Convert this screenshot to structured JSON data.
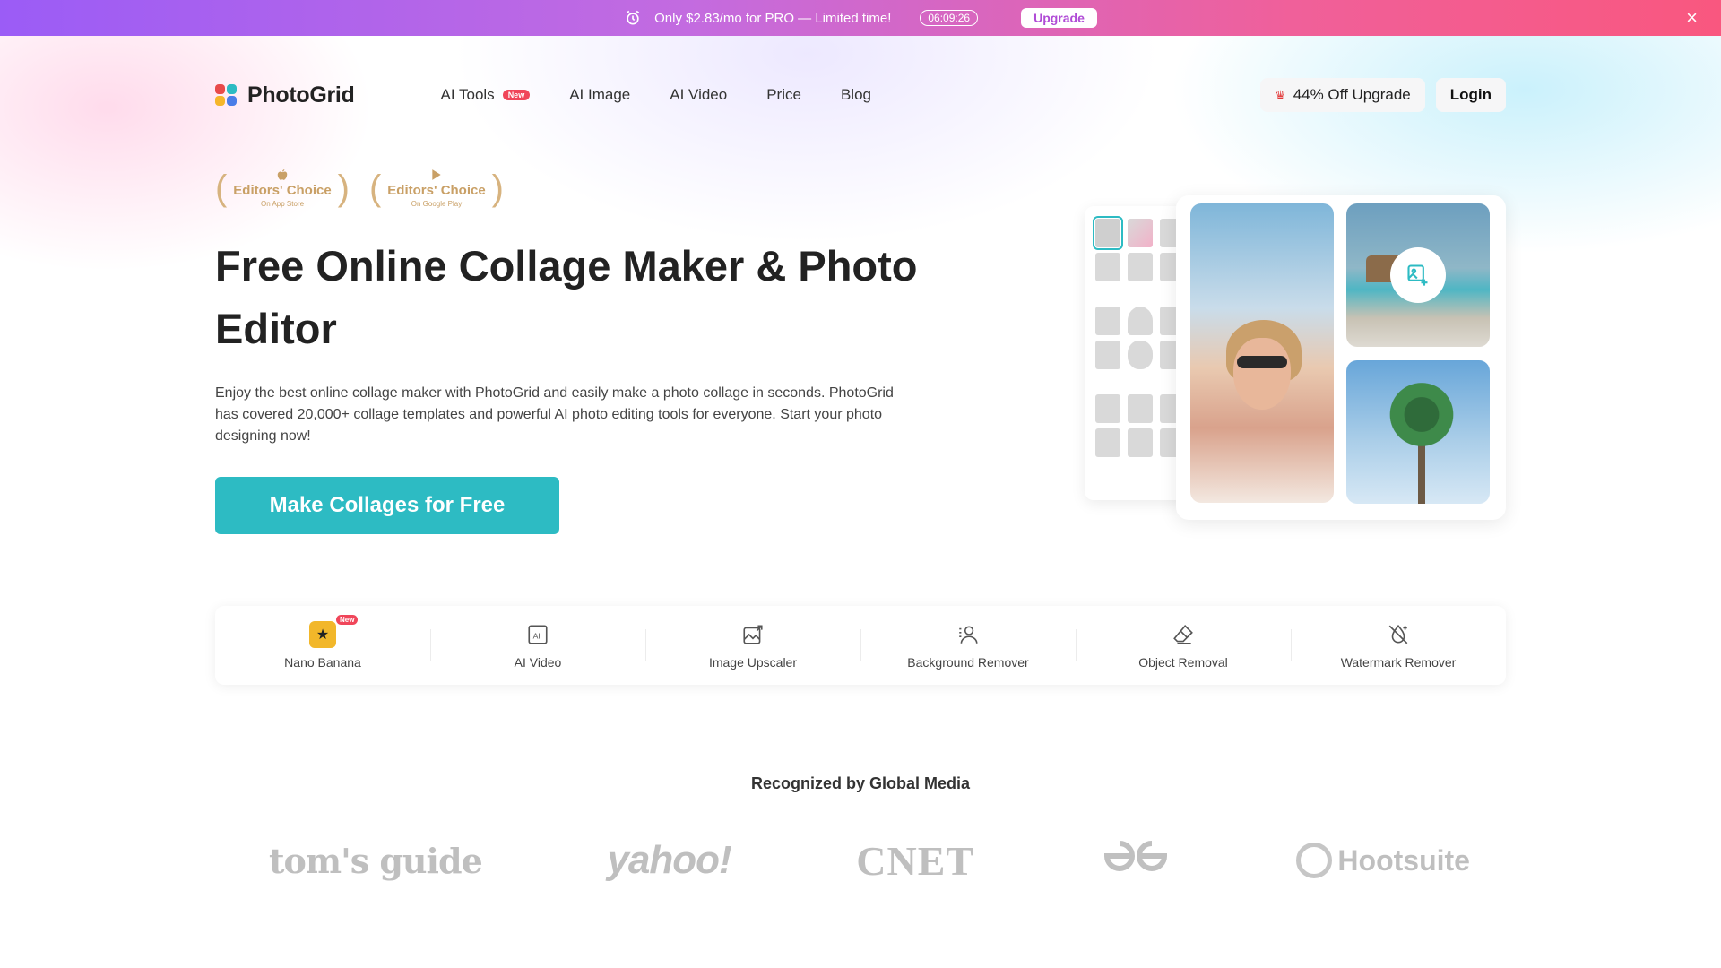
{
  "promo": {
    "text": "Only $2.83/mo for PRO — Limited time!",
    "timer": "06:09:26",
    "upgrade_label": "Upgrade",
    "close_icon": "×"
  },
  "nav": {
    "logo_text": "PhotoGrid",
    "links": [
      {
        "label": "AI Tools",
        "badge": "New"
      },
      {
        "label": "AI Image"
      },
      {
        "label": "AI Video"
      },
      {
        "label": "Price"
      },
      {
        "label": "Blog"
      }
    ],
    "offer_label": "44% Off Upgrade",
    "login_label": "Login"
  },
  "awards": [
    {
      "title": "Editors' Choice",
      "sub": "On App Store",
      "icon": "apple-icon"
    },
    {
      "title": "Editors' Choice",
      "sub": "On Google Play",
      "icon": "google-play-icon"
    }
  ],
  "hero": {
    "title": "Free Online Collage Maker & Photo Editor",
    "description": "Enjoy the best online collage maker with PhotoGrid and easily make a photo collage in seconds. PhotoGrid has covered 20,000+ collage templates and powerful AI photo editing tools for everyone. Start your photo designing now!",
    "cta_label": "Make Collages for Free"
  },
  "tools": [
    {
      "label": "Nano Banana",
      "icon": "nano-banana-icon",
      "badge": "New"
    },
    {
      "label": "AI Video",
      "icon": "ai-video-icon"
    },
    {
      "label": "Image Upscaler",
      "icon": "image-upscaler-icon"
    },
    {
      "label": "Background Remover",
      "icon": "background-remover-icon"
    },
    {
      "label": "Object Removal",
      "icon": "eraser-icon"
    },
    {
      "label": "Watermark Remover",
      "icon": "watermark-remover-icon"
    }
  ],
  "media": {
    "title": "Recognized by Global Media",
    "logos": [
      "tom's guide",
      "yahoo!",
      "CNET",
      "GfG",
      "Hootsuite"
    ]
  },
  "colors": {
    "accent": "#2dbbc3",
    "badge": "#f0465a"
  }
}
